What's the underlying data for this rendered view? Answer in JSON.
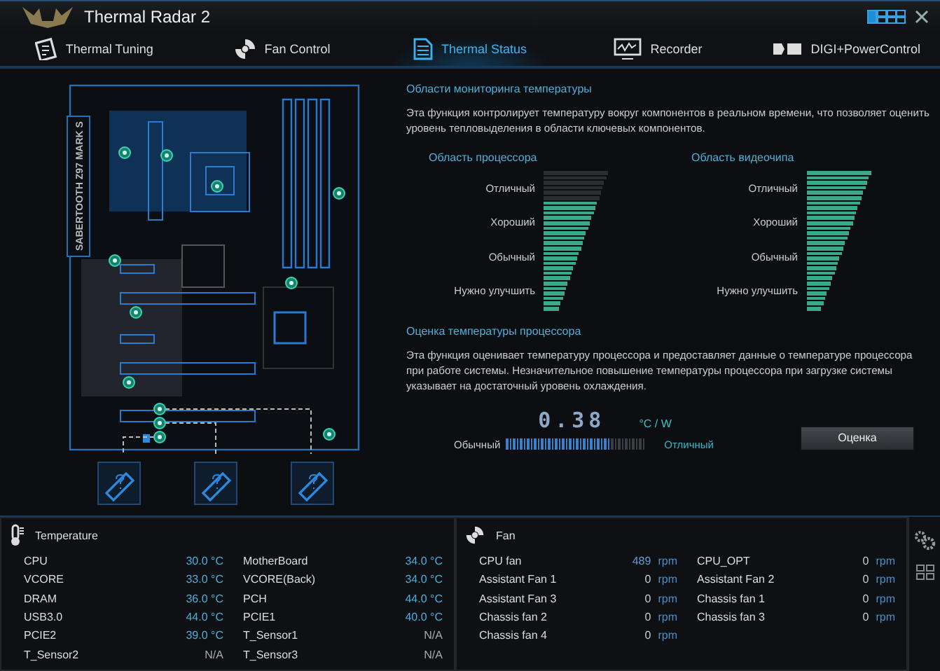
{
  "window": {
    "title": "Thermal Radar 2"
  },
  "tabs": [
    {
      "label": "Thermal Tuning",
      "selected": false,
      "kind": "tuning"
    },
    {
      "label": "Fan Control",
      "selected": false,
      "kind": "fan"
    },
    {
      "label": "Thermal Status",
      "selected": true,
      "kind": "status"
    },
    {
      "label": "Recorder",
      "selected": false,
      "kind": "recorder"
    },
    {
      "label": "DIGI+PowerControl",
      "selected": false,
      "kind": "digi"
    }
  ],
  "board": {
    "label": "SABERTOOTH Z97 MARK S"
  },
  "monitoring": {
    "title": "Области мониторинга температуры",
    "description": "Эта функция контролирует температуру вокруг компонентов в реальном времени, что позволяет оценить уровень тепловыделения в области ключевых компонентов.",
    "zones": [
      {
        "title": "Область процессора",
        "level": 0.77,
        "grades": [
          "Отличный",
          "Хороший",
          "Обычный",
          "Нужно улучшить"
        ]
      },
      {
        "title": "Область видеочипа",
        "level": 1,
        "grades": [
          "Отличный",
          "Хороший",
          "Обычный",
          "Нужно улучшить"
        ]
      }
    ]
  },
  "assessment": {
    "title": "Оценка температуры процессора",
    "description": "Эта функция оценивает температуру процессора и предоставляет данные о температуре процессора при работе системы. Незначительное повышение температуры процессора при загрузке системы указывает на достаточный уровень охлаждения.",
    "value": "0.38",
    "unit": "°C / W",
    "low_label": "Обычный",
    "high_label": "Отличный",
    "level": 0.75,
    "button": "Оценка"
  },
  "temperature": {
    "title": "Temperature",
    "columns": [
      [
        {
          "name": "CPU",
          "value": "30.0 °C",
          "available": true
        },
        {
          "name": "VCORE",
          "value": "33.0 °C",
          "available": true
        },
        {
          "name": "DRAM",
          "value": "36.0 °C",
          "available": true
        },
        {
          "name": "USB3.0",
          "value": "44.0 °C",
          "available": true
        },
        {
          "name": "PCIE2",
          "value": "39.0 °C",
          "available": true
        },
        {
          "name": "T_Sensor2",
          "value": "N/A",
          "available": false
        }
      ],
      [
        {
          "name": "MotherBoard",
          "value": "34.0 °C",
          "available": true
        },
        {
          "name": "VCORE(Back)",
          "value": "34.0 °C",
          "available": true
        },
        {
          "name": "PCH",
          "value": "44.0 °C",
          "available": true
        },
        {
          "name": "PCIE1",
          "value": "40.0 °C",
          "available": true
        },
        {
          "name": "T_Sensor1",
          "value": "N/A",
          "available": false
        },
        {
          "name": "T_Sensor3",
          "value": "N/A",
          "available": false
        }
      ]
    ]
  },
  "fan": {
    "title": "Fan",
    "columns": [
      [
        {
          "name": "CPU fan",
          "value": "489",
          "unit": "rpm",
          "active": true
        },
        {
          "name": "Assistant Fan 1",
          "value": "0",
          "unit": "rpm",
          "active": false
        },
        {
          "name": "Assistant Fan 3",
          "value": "0",
          "unit": "rpm",
          "active": false
        },
        {
          "name": "Chassis fan 2",
          "value": "0",
          "unit": "rpm",
          "active": false
        },
        {
          "name": "Chassis fan 4",
          "value": "0",
          "unit": "rpm",
          "active": false
        }
      ],
      [
        {
          "name": "CPU_OPT",
          "value": "0",
          "unit": "rpm",
          "active": false
        },
        {
          "name": "Assistant Fan 2",
          "value": "0",
          "unit": "rpm",
          "active": false
        },
        {
          "name": "Chassis fan 1",
          "value": "0",
          "unit": "rpm",
          "active": false
        },
        {
          "name": "Chassis fan 3",
          "value": "0",
          "unit": "rpm",
          "active": false
        }
      ]
    ]
  }
}
